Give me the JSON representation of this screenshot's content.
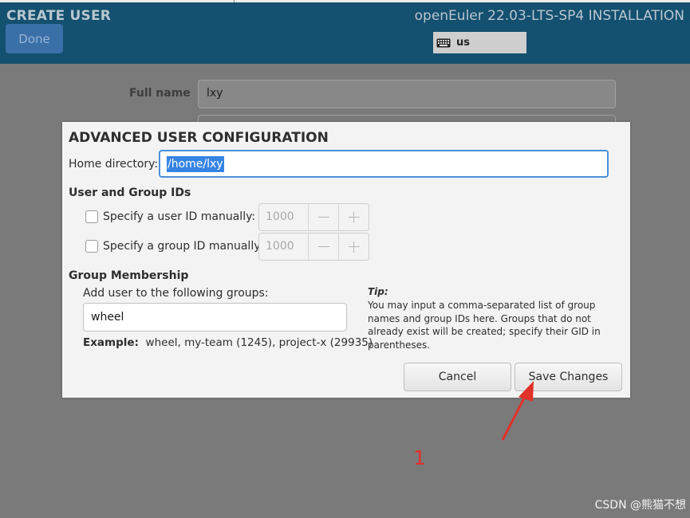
{
  "header": {
    "title": "CREATE USER",
    "done_label": "Done",
    "install_title": "openEuler 22.03-LTS-SP4 INSTALLATION",
    "keyboard_layout": "us"
  },
  "background_form": {
    "full_name_label": "Full name",
    "full_name_value": "lxy"
  },
  "dialog": {
    "title": "ADVANCED USER CONFIGURATION",
    "home_label": "Home directory:",
    "home_value": "/home/lxy",
    "ids_section": "User and Group IDs",
    "user_id_label": "Specify a user ID manually:",
    "user_id_value": "1000",
    "group_id_label": "Specify a group ID manually:",
    "group_id_value": "1000",
    "membership_section": "Group Membership",
    "add_groups_label": "Add user to the following groups:",
    "groups_value": "wheel",
    "example_label": "Example:",
    "example_text": "wheel, my-team (1245), project-x (29935)",
    "tip_title": "Tip:",
    "tip_text": "You may input a comma-separated list of group names and group IDs here. Groups that do not already exist will be created; specify their GID in parentheses.",
    "cancel_label": "Cancel",
    "save_label": "Save Changes"
  },
  "annotation": {
    "number": "1",
    "color": "#e0312a"
  },
  "watermark": "CSDN @熊猫不想"
}
